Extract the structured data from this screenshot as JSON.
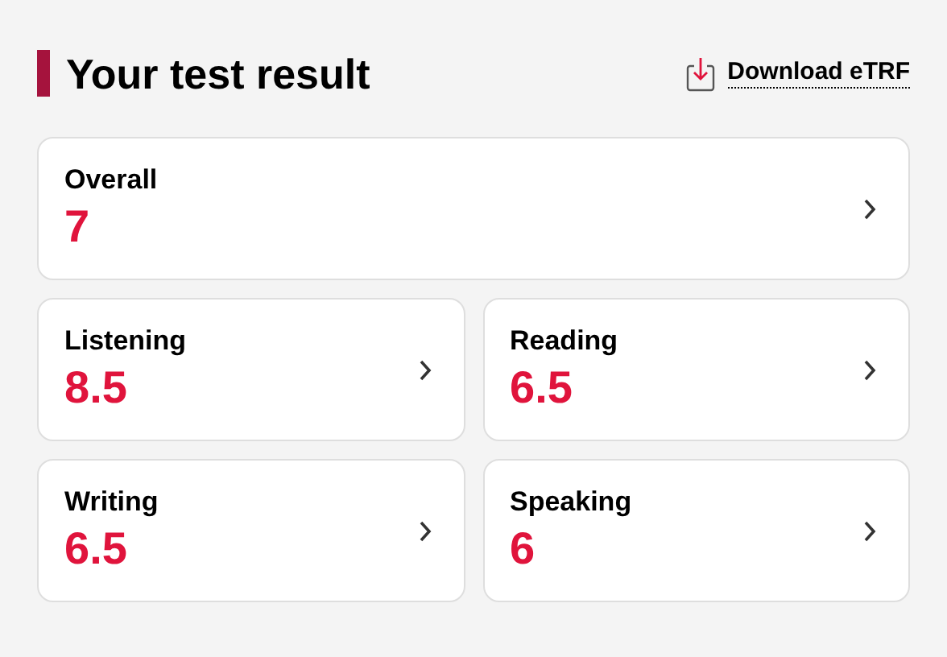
{
  "title": "Your test result",
  "download": {
    "label": "Download eTRF"
  },
  "overall": {
    "label": "Overall",
    "score": "7"
  },
  "skills": [
    {
      "label": "Listening",
      "score": "8.5"
    },
    {
      "label": "Reading",
      "score": "6.5"
    },
    {
      "label": "Writing",
      "score": "6.5"
    },
    {
      "label": "Speaking",
      "score": "6"
    }
  ]
}
